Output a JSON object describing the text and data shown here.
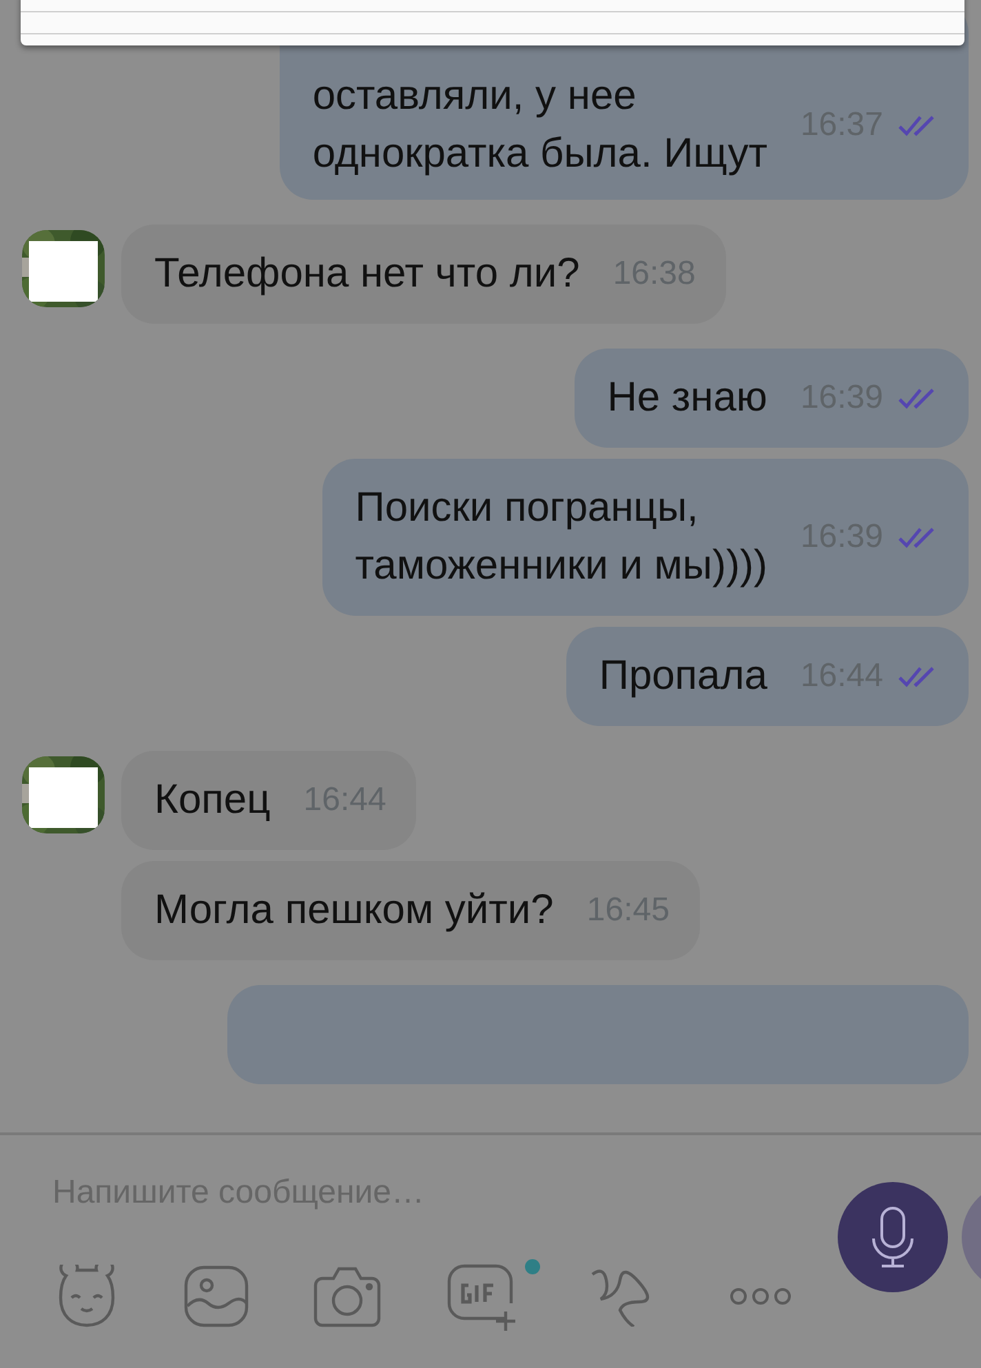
{
  "messages": [
    {
      "kind": "outgoing",
      "text": "оставляли, у нее\nоднократка была. Ищут",
      "time": "16:37",
      "read": true
    },
    {
      "kind": "incoming",
      "avatar": true,
      "text": "Телефона нет что ли?",
      "time": "16:38"
    },
    {
      "kind": "outgoing",
      "text": "Не знаю",
      "time": "16:39",
      "read": true
    },
    {
      "kind": "outgoing",
      "text": "Поиски погранцы,\nтаможенники и мы))))",
      "time": "16:39",
      "read": true
    },
    {
      "kind": "outgoing",
      "text": "Пропала",
      "time": "16:44",
      "read": true
    },
    {
      "kind": "incoming",
      "avatar": true,
      "text": "Копец",
      "time": "16:44"
    },
    {
      "kind": "incoming",
      "avatar": false,
      "text": "Могла пешком уйти?",
      "time": "16:45"
    },
    {
      "kind": "outgoing"
    }
  ],
  "composer": {
    "placeholder": "Напишите сообщение…",
    "gif_badge": true
  }
}
